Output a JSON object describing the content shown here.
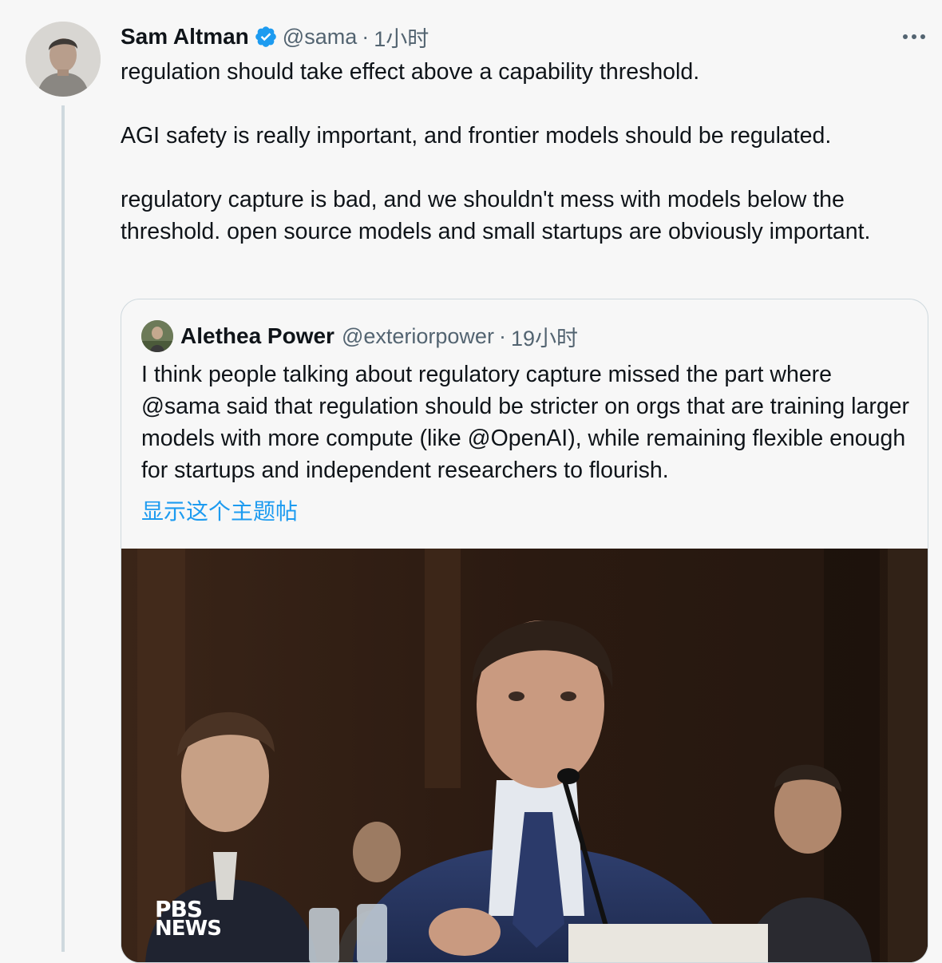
{
  "tweet": {
    "author_name": "Sam Altman",
    "handle": "@sama",
    "separator": "·",
    "time": "1小时",
    "paragraphs": [
      "regulation should take effect above a capability threshold.",
      "AGI safety is really important, and frontier models should be regulated.",
      "regulatory capture is bad, and we shouldn't mess with models below the threshold. open source models and small startups are obviously important."
    ],
    "icons": {
      "verified": "verified-badge-icon",
      "more": "more-options-icon"
    },
    "colors": {
      "verified": "#1d9bf0",
      "link": "#1d9bf0",
      "secondary_text": "#536471"
    }
  },
  "quote": {
    "author_name": "Alethea Power",
    "handle": "@exteriorpower",
    "separator": "·",
    "time": "19小时",
    "text": "I think people talking about regulatory capture missed the part where @sama said that regulation should be stricter on orgs that are training larger models with more compute (like @OpenAI), while remaining flexible enough for startups and independent researchers to flourish.",
    "show_thread": "显示这个主题帖",
    "media": {
      "logo_line1": "PBS",
      "logo_line2": "NEWS"
    }
  }
}
